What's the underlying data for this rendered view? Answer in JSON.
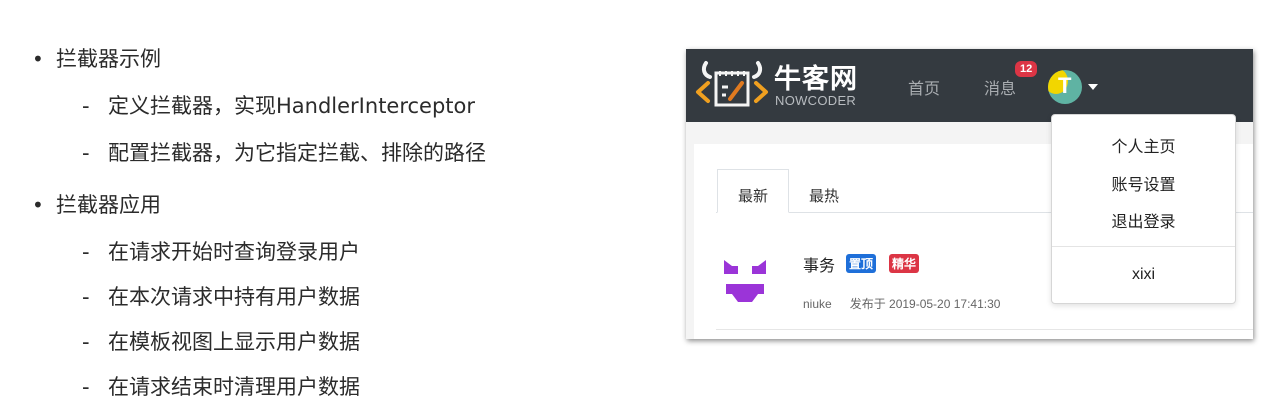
{
  "slide": {
    "sections": [
      {
        "title": "拦截器示例",
        "items": [
          "定义拦截器，实现HandlerInterceptor",
          "配置拦截器，为它指定拦截、排除的路径"
        ]
      },
      {
        "title": "拦截器应用",
        "items": [
          "在请求开始时查询登录用户",
          "在本次请求中持有用户数据",
          "在模板视图上显示用户数据",
          "在请求结束时清理用户数据"
        ]
      }
    ],
    "bullet_symbol": "•",
    "dash_symbol": "-"
  },
  "screenshot": {
    "navbar": {
      "brand": "牛客网",
      "brand_sub": "NOWCODER",
      "home_label": "首页",
      "messages_label": "消息",
      "messages_badge": "12",
      "avatar_icon": "avatar-icon",
      "colors": {
        "background": "#343a40",
        "badge": "#dc3545"
      }
    },
    "tabs": [
      "最新",
      "最热"
    ],
    "post": {
      "title": "事务",
      "tag_top": "置顶",
      "tag_best": "精华",
      "author": "niuke",
      "published": "发布于 2019-05-20 17:41:30",
      "colors": {
        "tag_top": "#1e6fd9",
        "tag_best": "#dc3545",
        "avatar": "#9b34d8"
      }
    },
    "dropdown": {
      "items": [
        "个人主页",
        "账号设置",
        "退出登录"
      ],
      "username": "xixi"
    }
  }
}
